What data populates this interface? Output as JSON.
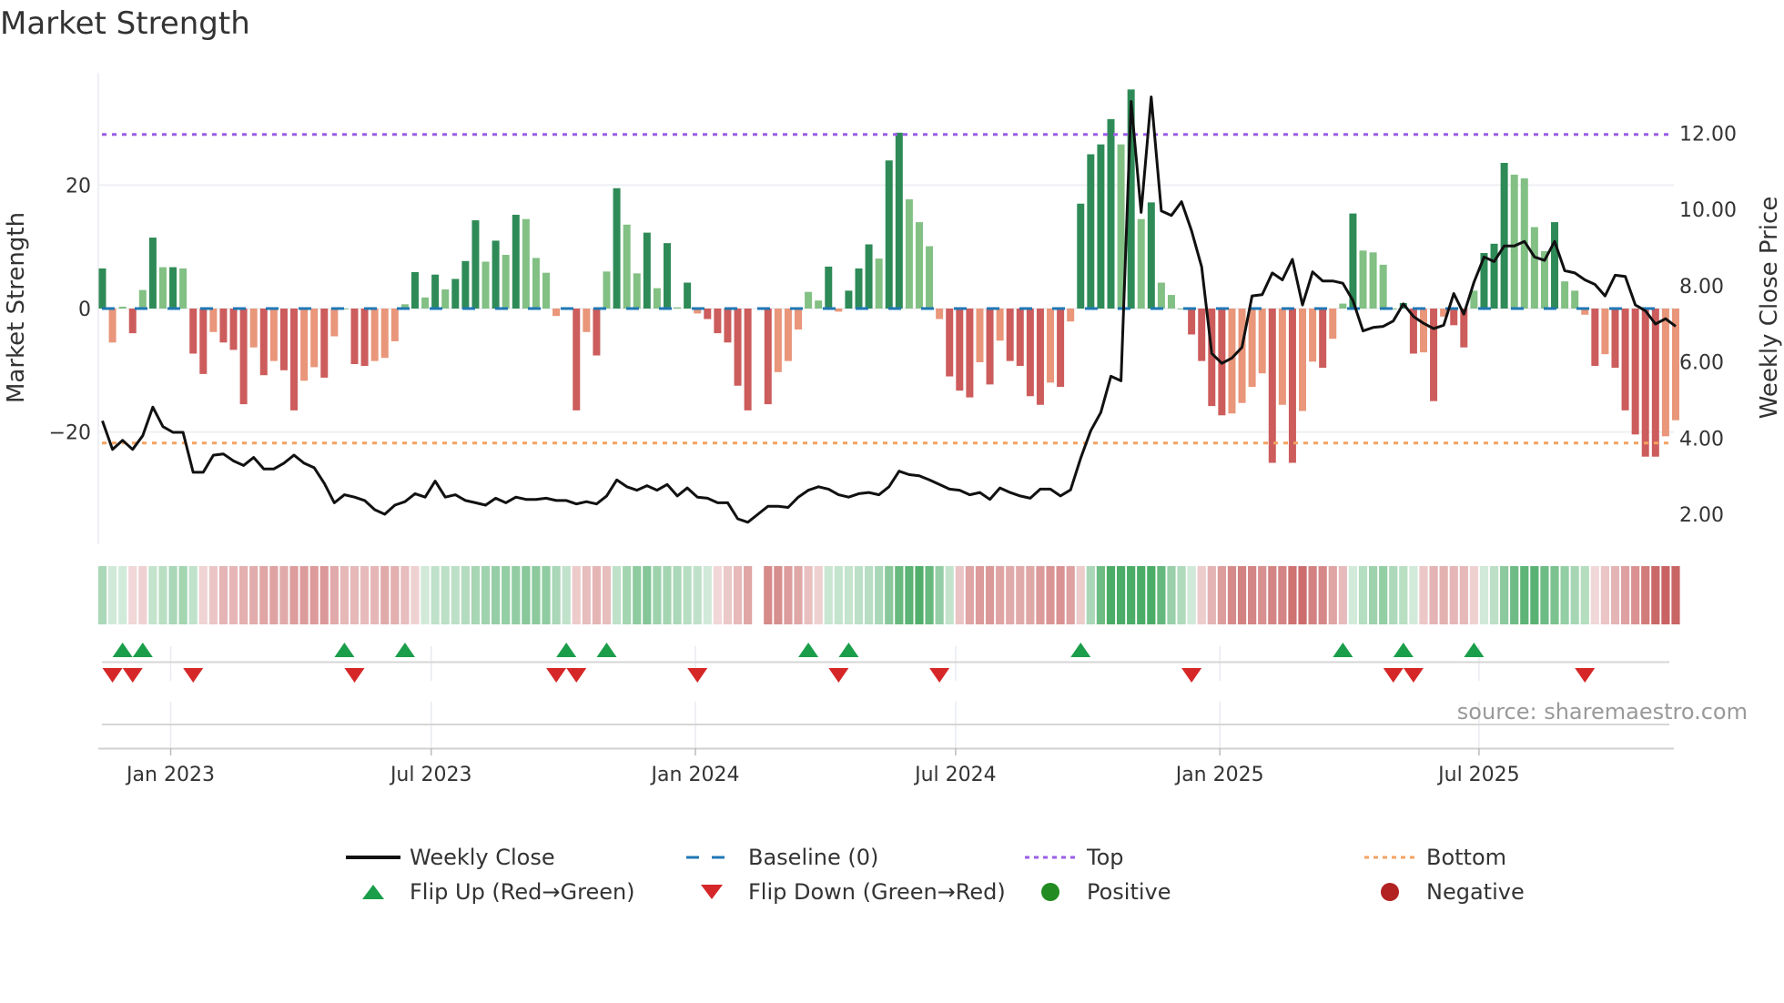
{
  "title": "Market Strength",
  "source": "source: sharemaestro.com",
  "legend": {
    "weekly_close": "Weekly Close",
    "baseline": "Baseline (0)",
    "top": "Top",
    "bottom": "Bottom",
    "flip_up": "Flip Up (Red→Green)",
    "flip_down": "Flip Down (Green→Red)",
    "positive": "Positive",
    "negative": "Negative"
  },
  "colors": {
    "pos_strong": "#2e8b57",
    "pos_weak": "#82c084",
    "neg_strong": "#cd5c5c",
    "neg_weak": "#e9967a",
    "close_line": "#111111",
    "baseline": "#1f77b4",
    "top": "#9b5de5",
    "bottom": "#f4a261",
    "flip_up": "#1a9e4a",
    "flip_down": "#d62728",
    "positive": "#228b22",
    "negative": "#b22222"
  },
  "chart_data": {
    "type": "bar",
    "title": "Market Strength",
    "xlabel": "",
    "ylabel": "Market Strength",
    "y2label": "Weekly Close Price",
    "ylim": [
      -38.5,
      40
    ],
    "y2lim": [
      1.2,
      13.8
    ],
    "y_ticks": [
      {
        "v": 20,
        "label": "20"
      },
      {
        "v": 0,
        "label": "0"
      },
      {
        "v": -20,
        "label": "−20"
      }
    ],
    "y2_ticks": [
      {
        "v": 12,
        "label": "12.00"
      },
      {
        "v": 10,
        "label": "10.00"
      },
      {
        "v": 8,
        "label": "8.00"
      },
      {
        "v": 6,
        "label": "6.00"
      },
      {
        "v": 4,
        "label": "4.00"
      },
      {
        "v": 2,
        "label": "2.00"
      }
    ],
    "x_unit": "week index",
    "x_ticks": [
      {
        "at": 6.77,
        "label": "Jan 2023"
      },
      {
        "at": 32.6,
        "label": "Jul 2023"
      },
      {
        "at": 58.8,
        "label": "Jan 2024"
      },
      {
        "at": 84.6,
        "label": "Jul 2024"
      },
      {
        "at": 110.8,
        "label": "Jan 2025"
      },
      {
        "at": 136.5,
        "label": "Jul 2025"
      }
    ],
    "top_level": 28.2,
    "bottom_level": -21.8,
    "baseline": 0,
    "strength": [
      6.5,
      -5.5,
      0.3,
      -4,
      3,
      11.5,
      6.7,
      6.7,
      6.5,
      -7.3,
      -10.6,
      -3.8,
      -5.5,
      -6.7,
      -15.5,
      -6.3,
      -10.8,
      -8.5,
      -10,
      -16.5,
      -11.7,
      -9.5,
      -11.2,
      -4.5,
      0,
      -9,
      -9.3,
      -8.5,
      -8,
      -5.3,
      0.7,
      5.9,
      1.8,
      5.5,
      3.1,
      4.8,
      7.7,
      14.3,
      7.6,
      11,
      8.7,
      15.2,
      14.5,
      8.2,
      5.8,
      -1.2,
      0,
      -16.5,
      -3.8,
      -7.6,
      6,
      19.5,
      13.6,
      5.7,
      12.3,
      3.3,
      10.6,
      0.2,
      4.2,
      -0.8,
      -1.7,
      -4,
      -5.5,
      -12.5,
      -16.5,
      null,
      -15.5,
      -10.3,
      -8.5,
      -3.4,
      2.7,
      1.3,
      6.8,
      -0.5,
      2.9,
      6.5,
      10.4,
      8.1,
      24,
      28.5,
      17.7,
      14,
      10.1,
      -1.7,
      -11,
      -13.3,
      -14.4,
      -8.7,
      -12.3,
      -5.2,
      -8.5,
      -9.3,
      -14.2,
      -15.6,
      -12,
      -12.7,
      -2.1,
      17,
      25,
      26.6,
      30.7,
      26.6,
      35.5,
      14.5,
      17.2,
      4.2,
      2.2,
      0,
      -4.2,
      -8.5,
      -15.8,
      -17.3,
      -17,
      -15.3,
      -12.7,
      -10.5,
      -25,
      -15.6,
      -25,
      -16.6,
      -8.6,
      -9.6,
      -4.9,
      0.8,
      15.4,
      9.4,
      9.1,
      7.1,
      0,
      0.9,
      -7.3,
      -7.1,
      -15,
      -1.3,
      -2.7,
      -6.3,
      2.9,
      9,
      10.5,
      23.6,
      21.7,
      21.1,
      13.2,
      9.3,
      14,
      4.4,
      2.9,
      -1,
      -9.3,
      -7.4,
      -9.6,
      -16.5,
      -20.4,
      -24,
      -24,
      -20.7,
      -18.1
    ],
    "weekly_close": [
      4.45,
      3.7,
      3.94,
      3.7,
      4.06,
      4.81,
      4.3,
      4.15,
      4.15,
      3.1,
      3.1,
      3.55,
      3.58,
      3.4,
      3.28,
      3.49,
      3.19,
      3.19,
      3.34,
      3.55,
      3.34,
      3.22,
      2.81,
      2.3,
      2.51,
      2.45,
      2.36,
      2.12,
      2.0,
      2.24,
      2.33,
      2.54,
      2.45,
      2.87,
      2.45,
      2.51,
      2.36,
      2.3,
      2.24,
      2.42,
      2.3,
      2.45,
      2.39,
      2.39,
      2.42,
      2.36,
      2.36,
      2.27,
      2.33,
      2.27,
      2.48,
      2.9,
      2.72,
      2.63,
      2.75,
      2.63,
      2.78,
      2.48,
      2.69,
      2.45,
      2.42,
      2.3,
      2.3,
      1.88,
      1.79,
      2.0,
      2.21,
      2.21,
      2.18,
      2.45,
      2.63,
      2.72,
      2.66,
      2.51,
      2.45,
      2.54,
      2.57,
      2.51,
      2.72,
      3.13,
      3.04,
      3.01,
      2.9,
      2.78,
      2.66,
      2.63,
      2.51,
      2.57,
      2.39,
      2.69,
      2.57,
      2.48,
      2.42,
      2.66,
      2.66,
      2.48,
      2.64,
      3.47,
      4.19,
      4.67,
      5.62,
      5.5,
      12.83,
      9.92,
      12.95,
      9.96,
      9.84,
      10.2,
      9.44,
      8.49,
      6.22,
      5.96,
      6.1,
      6.38,
      7.73,
      7.76,
      8.33,
      8.15,
      8.69,
      7.49,
      8.36,
      8.12,
      8.12,
      8.06,
      7.61,
      6.81,
      6.9,
      6.93,
      7.07,
      7.52,
      7.19,
      7.01,
      6.87,
      6.96,
      7.79,
      7.25,
      8.09,
      8.75,
      8.63,
      9.04,
      9.04,
      9.16,
      8.75,
      8.66,
      9.16,
      8.39,
      8.33,
      8.15,
      8.03,
      7.73,
      8.27,
      8.24,
      7.49,
      7.34,
      6.99,
      7.13,
      6.93
    ],
    "flip_up": [
      2,
      4,
      24,
      30,
      46,
      50,
      70,
      74,
      97,
      123,
      129,
      136
    ],
    "flip_down": [
      1,
      3,
      9,
      25,
      45,
      47,
      59,
      73,
      83,
      108,
      128,
      130,
      147
    ],
    "grid": true,
    "legend_position": "bottom"
  }
}
